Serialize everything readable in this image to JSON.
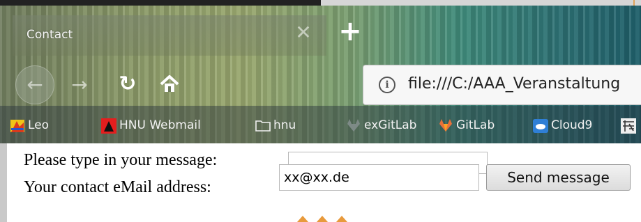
{
  "browser": {
    "tab": {
      "title": "Contact",
      "close_icon": "close-icon"
    },
    "new_tab_icon": "plus-icon",
    "nav": {
      "back_icon": "arrow-left-icon",
      "forward_icon": "arrow-right-icon",
      "reload_icon": "reload-icon",
      "home_icon": "home-icon"
    },
    "urlbar": {
      "info_icon": "info-icon",
      "url": "file:///C:/AAA_Veranstaltung"
    },
    "bookmarks": [
      {
        "label": "Leo",
        "icon": "leo-icon"
      },
      {
        "label": "HNU Webmail",
        "icon": "hnu-icon"
      },
      {
        "label": "hnu",
        "icon": "folder-icon"
      },
      {
        "label": "exGitLab",
        "icon": "gitlab-gray-icon"
      },
      {
        "label": "GitLab",
        "icon": "gitlab-icon"
      },
      {
        "label": "Cloud9",
        "icon": "cloud9-icon"
      }
    ]
  },
  "form": {
    "message_label": "Please type in your message:",
    "message_value": "",
    "email_label": "Your contact eMail address:",
    "email_value": "xx@xx.de",
    "send_label": "Send message"
  },
  "colors": {
    "theme_green": "#8b9a69",
    "theme_teal": "#2c6f73",
    "orange_accent": "#e89a3c"
  }
}
